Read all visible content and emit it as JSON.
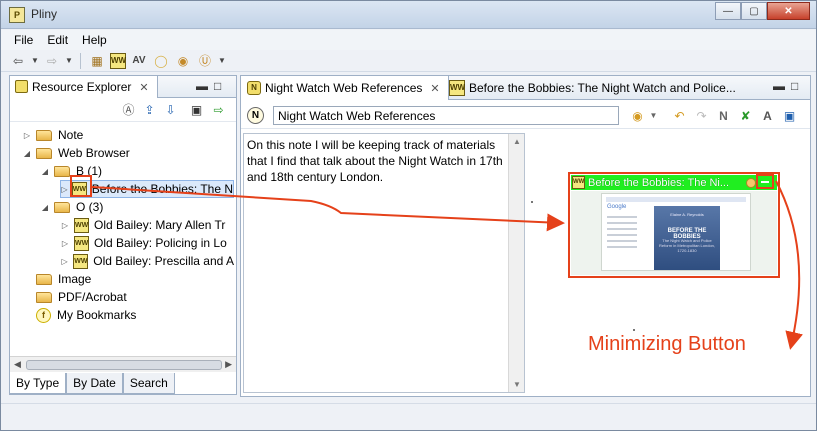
{
  "window": {
    "title": "Pliny",
    "app_icon": "pliny-app-icon"
  },
  "menu": [
    "File",
    "Edit",
    "Help"
  ],
  "left_panel": {
    "tab_label": "Resource Explorer",
    "tree": [
      {
        "label": "Note",
        "type": "folder",
        "expanded": false,
        "depth": 0
      },
      {
        "label": "Web Browser",
        "type": "folder",
        "expanded": true,
        "depth": 0
      },
      {
        "label": "B (1)",
        "type": "folder",
        "expanded": true,
        "depth": 1
      },
      {
        "label": "Before the Bobbies: The N",
        "type": "web",
        "expanded": false,
        "depth": 2,
        "selected": true
      },
      {
        "label": "O (3)",
        "type": "folder",
        "expanded": true,
        "depth": 1
      },
      {
        "label": "Old Bailey: Mary Allen Tr",
        "type": "web",
        "expanded": false,
        "depth": 2
      },
      {
        "label": "Old Bailey: Policing in Lo",
        "type": "web",
        "expanded": false,
        "depth": 2
      },
      {
        "label": "Old Bailey: Prescilla and A",
        "type": "web",
        "expanded": false,
        "depth": 2
      },
      {
        "label": "Image",
        "type": "folder",
        "expanded": false,
        "depth": 0
      },
      {
        "label": "PDF/Acrobat",
        "type": "folder",
        "expanded": false,
        "depth": 0
      },
      {
        "label": "My Bookmarks",
        "type": "bookmarks",
        "expanded": false,
        "depth": 0
      }
    ],
    "bottom_tabs": [
      "By Type",
      "By Date",
      "Search"
    ]
  },
  "editor": {
    "tabs": [
      {
        "label": "Night Watch Web References",
        "active": true
      },
      {
        "label": "Before the Bobbies: The Night Watch and Police...",
        "active": false
      }
    ],
    "note_title": "Night Watch Web References",
    "note_text": "On this note I will be keeping track of materials that I find that talk about the Night Watch in 17th and 18th century London.",
    "thumbnail": {
      "title": "Before the Bobbies: The Ni...",
      "book_author": "Elaine A. Reynolds",
      "book_title": "BEFORE THE BOBBIES",
      "book_subtitle": "The Night Watch and Police Reform in Metropolitan London, 1720-1830",
      "page_logo": "Google"
    }
  },
  "annotation": {
    "label": "Minimizing Button",
    "color": "#e5411a"
  },
  "colors": {
    "accent_green": "#20ee20",
    "annotation_red": "#e5411a"
  }
}
